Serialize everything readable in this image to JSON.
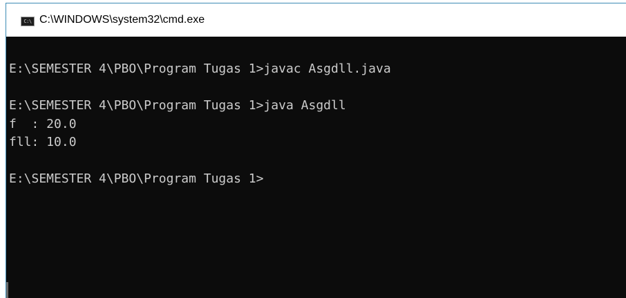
{
  "window": {
    "icon_text": "C:\\",
    "title": "C:\\WINDOWS\\system32\\cmd.exe"
  },
  "console": {
    "lines": [
      "E:\\SEMESTER 4\\PBO\\Program Tugas 1>javac Asgdll.java",
      "",
      "E:\\SEMESTER 4\\PBO\\Program Tugas 1>java Asgdll",
      "f  : 20.0",
      "fll: 10.0",
      "",
      "E:\\SEMESTER 4\\PBO\\Program Tugas 1>"
    ]
  }
}
